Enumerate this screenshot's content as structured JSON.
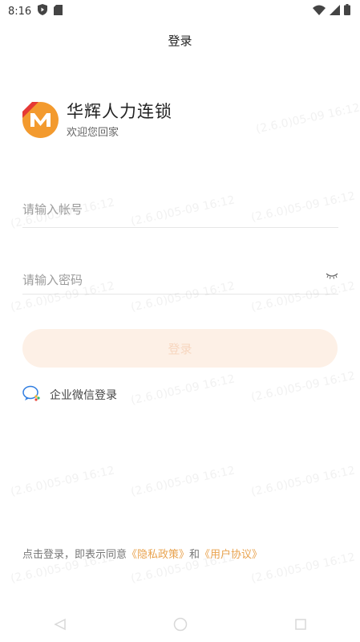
{
  "status_bar": {
    "time": "8:16"
  },
  "header": {
    "title": "登录"
  },
  "brand": {
    "name": "华辉人力连锁",
    "subtitle": "欢迎您回家"
  },
  "form": {
    "account_placeholder": "请输入帐号",
    "password_placeholder": "请输入密码",
    "login_label": "登录",
    "wework_label": "企业微信登录"
  },
  "agreement": {
    "prefix": "点击登录，即表示同意",
    "privacy": "《隐私政策》",
    "and": "和",
    "terms": "《用户协议》"
  },
  "watermark": {
    "text": "(2.6.0)05-09 16:12"
  },
  "colors": {
    "accent": "#e9a34f",
    "button_bg": "#fdf0e6",
    "logo_orange": "#f39a2e"
  }
}
